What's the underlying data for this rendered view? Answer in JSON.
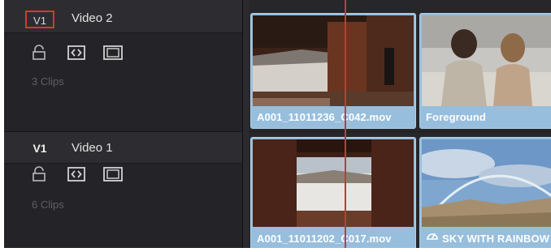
{
  "tracks": [
    {
      "id": "V1",
      "name": "Video 2",
      "clips": "3 Clips"
    },
    {
      "id": "V1",
      "name": "Video 1",
      "clips": "6 Clips"
    }
  ],
  "timeline": {
    "video2_clips": [
      {
        "label": "A001_11011236_C042.mov"
      },
      {
        "label": "Foreground"
      }
    ],
    "video1_clips": [
      {
        "label": "A001_11011202_C017.mov"
      },
      {
        "label": "SKY WITH RAINBOW"
      }
    ]
  },
  "icons": {
    "lock": "lock-icon",
    "auto_select": "auto-select-icon",
    "enable": "film-strip-icon",
    "speed": "speed-gauge-icon"
  },
  "colors": {
    "clip_blue": "#97bedd",
    "playhead": "#c23b37",
    "selection_box": "#d8372c"
  }
}
